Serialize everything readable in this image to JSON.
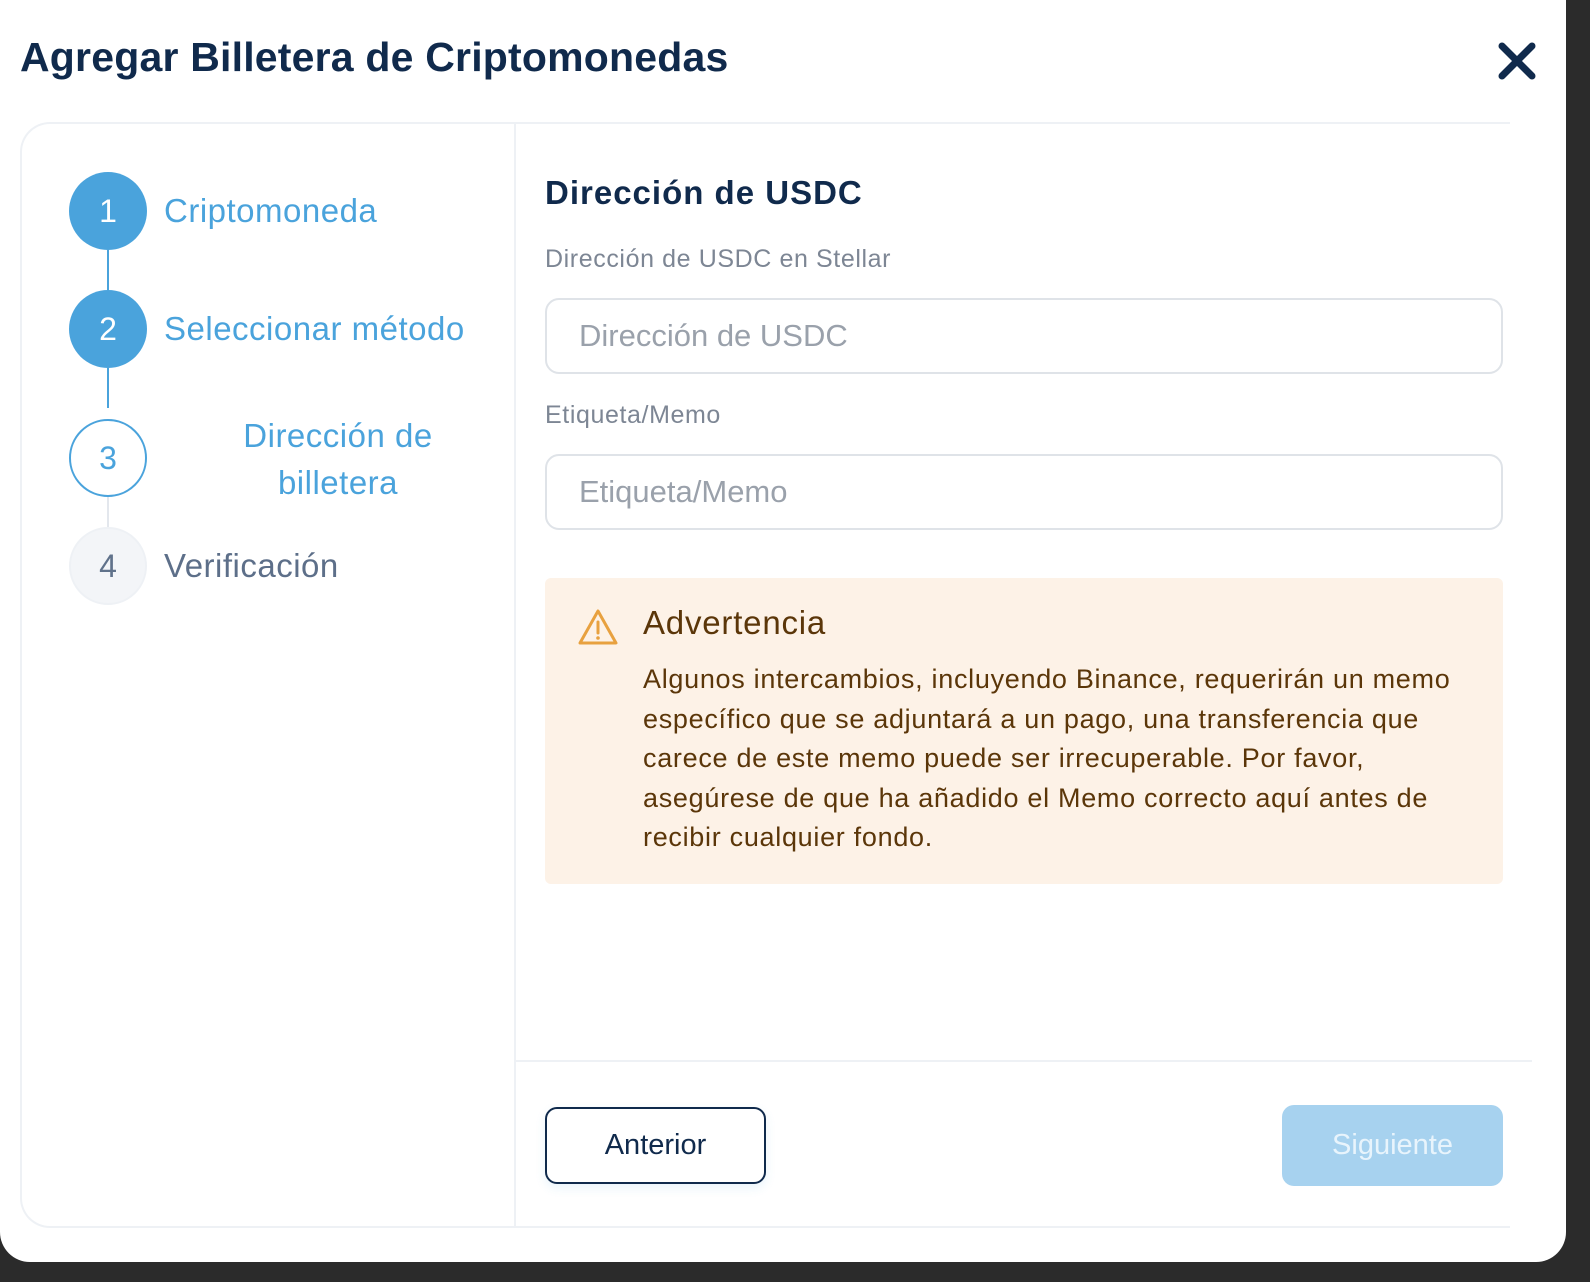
{
  "modal": {
    "title": "Agregar Billetera de Criptomonedas",
    "close_icon": "close-icon"
  },
  "stepper": {
    "steps": [
      {
        "number": "1",
        "label": "Criptomoneda",
        "state": "completed"
      },
      {
        "number": "2",
        "label": "Seleccionar método",
        "state": "completed"
      },
      {
        "number": "3",
        "label_line1": "Dirección de",
        "label_line2": "billetera",
        "state": "active"
      },
      {
        "number": "4",
        "label": "Verificación",
        "state": "pending"
      }
    ]
  },
  "form": {
    "section_title": "Dirección de USDC",
    "address": {
      "label": "Dirección de USDC en Stellar",
      "placeholder": "Dirección de USDC",
      "value": ""
    },
    "memo": {
      "label": "Etiqueta/Memo",
      "placeholder": "Etiqueta/Memo",
      "value": ""
    }
  },
  "warning": {
    "icon": "warning-triangle-icon",
    "title": "Advertencia",
    "text": "Algunos intercambios, incluyendo Binance, requerirán un memo específico que se adjuntará a un pago, una transferencia que carece de este memo puede ser irrecuperable. Por favor, asegúrese de que ha añadido el Memo correcto aquí antes de recibir cualquier fondo."
  },
  "footer": {
    "prev_label": "Anterior",
    "next_label": "Siguiente",
    "next_disabled": true
  },
  "colors": {
    "primary_navy": "#102a4c",
    "accent_blue": "#4aa3dc",
    "disabled_blue": "#a7d2ef",
    "warning_bg": "#fdf2e7",
    "warning_text": "#5b3609",
    "warning_icon": "#e8a13f"
  }
}
